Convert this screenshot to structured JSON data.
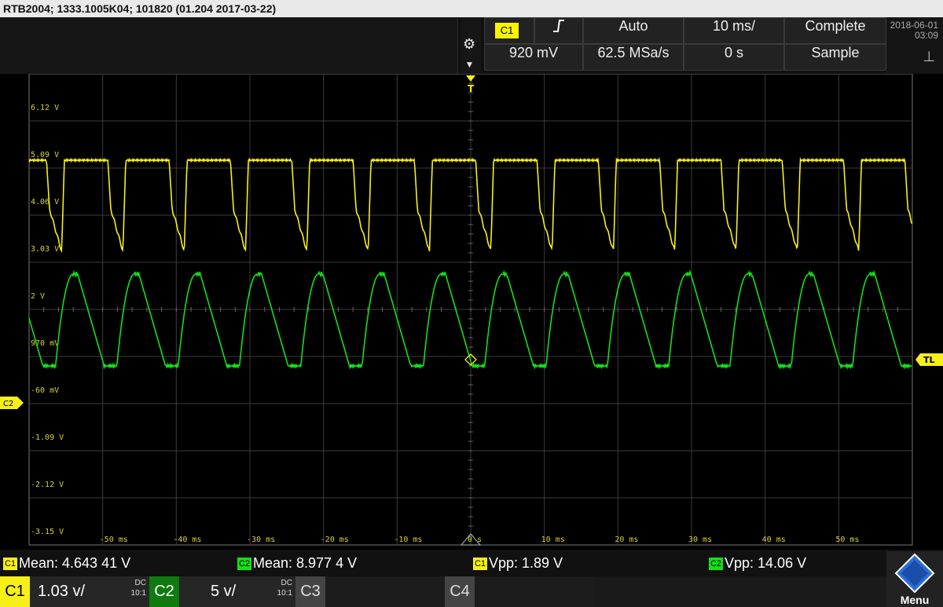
{
  "title_bar": "RTB2004; 1333.1005K04; 101820 (01.204 2017-03-22)",
  "top": {
    "trigger_source": "C1",
    "trigger_edge_icon": "rising-edge-icon",
    "trigger_mode": "Auto",
    "timebase": "10 ms/",
    "acq_state": "Complete",
    "trigger_level": "920 mV",
    "sample_rate": "62.5 MSa/s",
    "time_offset": "0 s",
    "acq_mode": "Sample",
    "date": "2018-06-01",
    "time": "03:09"
  },
  "colors": {
    "ch1": "#f7ef18",
    "ch2": "#12e01a",
    "grid": "#3c3c3c",
    "label_yellow": "#d8d030"
  },
  "markers": {
    "trigger": "T",
    "trigger_level": "TL",
    "ch2_ref": "C2"
  },
  "y_axis_labels": [
    "6.12 V",
    "5.09 V",
    "4.06 V",
    "3.03 V",
    "2 V",
    "970 mV",
    "-60 mV",
    "-1.09 V",
    "-2.12 V",
    "-3.15 V"
  ],
  "x_axis_labels": [
    "-50 ms",
    "-40 ms",
    "-30 ms",
    "-20 ms",
    "-10 ms",
    "0 s",
    "10 ms",
    "20 ms",
    "30 ms",
    "40 ms",
    "50 ms"
  ],
  "measurements": [
    {
      "ch": "C1",
      "text": "Mean: 4.643 41 V"
    },
    {
      "ch": "C2",
      "text": "Mean: 8.977 4 V"
    },
    {
      "ch": "C1",
      "text": "Vpp: 1.89 V"
    },
    {
      "ch": "C2",
      "text": "Vpp: 14.06 V"
    }
  ],
  "channels": [
    {
      "label": "C1",
      "scale": "1.03 v/",
      "coupling": "DC",
      "probe": "10:1"
    },
    {
      "label": "C2",
      "scale": "5 v/",
      "coupling": "DC",
      "probe": "10:1"
    },
    {
      "label": "C3"
    },
    {
      "label": "C4"
    }
  ],
  "menu_label": "Menu",
  "chart_data": {
    "type": "line",
    "x_unit": "ms",
    "xlim": [
      -60,
      60
    ],
    "x_ticks": [
      -50,
      -40,
      -30,
      -20,
      -10,
      0,
      10,
      20,
      30,
      40,
      50
    ],
    "y_ticks_label": [
      "6.12 V",
      "5.09 V",
      "4.06 V",
      "3.03 V",
      "2 V",
      "970 mV",
      "-60 mV",
      "-1.09 V",
      "-2.12 V",
      "-3.15 V"
    ],
    "grid": true,
    "period_ms": 8.33,
    "series": [
      {
        "name": "C1",
        "waveform": "pulse",
        "high_V": 5.09,
        "low_V": 3.1,
        "mean_V": 4.64341,
        "vpp_V": 1.89
      },
      {
        "name": "C2",
        "waveform": "sawtooth",
        "mean_V": 8.9774,
        "vpp_V": 14.06
      }
    ]
  }
}
